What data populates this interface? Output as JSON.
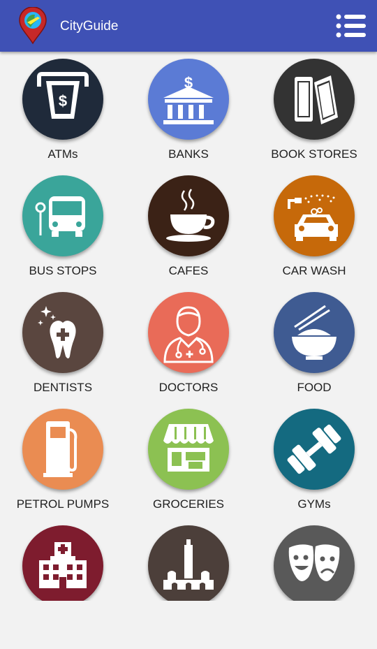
{
  "app": {
    "title": "CityGuide"
  },
  "colors": {
    "appbar": "#3f51b5",
    "background": "#f2f2f2"
  },
  "categories": [
    {
      "label": "ATMs",
      "icon": "atm-icon",
      "color": "#1f2a3a"
    },
    {
      "label": "BANKS",
      "icon": "bank-icon",
      "color": "#5b7bd5"
    },
    {
      "label": "BOOK STORES",
      "icon": "books-icon",
      "color": "#333333"
    },
    {
      "label": "BUS STOPS",
      "icon": "bus-icon",
      "color": "#3aa59a"
    },
    {
      "label": "CAFES",
      "icon": "coffee-cup-icon",
      "color": "#3b2216"
    },
    {
      "label": "CAR WASH",
      "icon": "car-wash-icon",
      "color": "#c6690a"
    },
    {
      "label": "DENTISTS",
      "icon": "tooth-icon",
      "color": "#5a463f"
    },
    {
      "label": "DOCTORS",
      "icon": "doctor-icon",
      "color": "#e96b58"
    },
    {
      "label": "FOOD",
      "icon": "food-bowl-icon",
      "color": "#3f5b92"
    },
    {
      "label": "PETROL PUMPS",
      "icon": "fuel-pump-icon",
      "color": "#ea8c52"
    },
    {
      "label": "GROCERIES",
      "icon": "grocery-store-icon",
      "color": "#8cc152"
    },
    {
      "label": "GYMs",
      "icon": "dumbbell-icon",
      "color": "#146a80"
    },
    {
      "label": "",
      "icon": "hospital-icon",
      "color": "#7e1c2e"
    },
    {
      "label": "",
      "icon": "mosque-icon",
      "color": "#4c3f3a"
    },
    {
      "label": "",
      "icon": "theater-masks-icon",
      "color": "#595959"
    }
  ]
}
